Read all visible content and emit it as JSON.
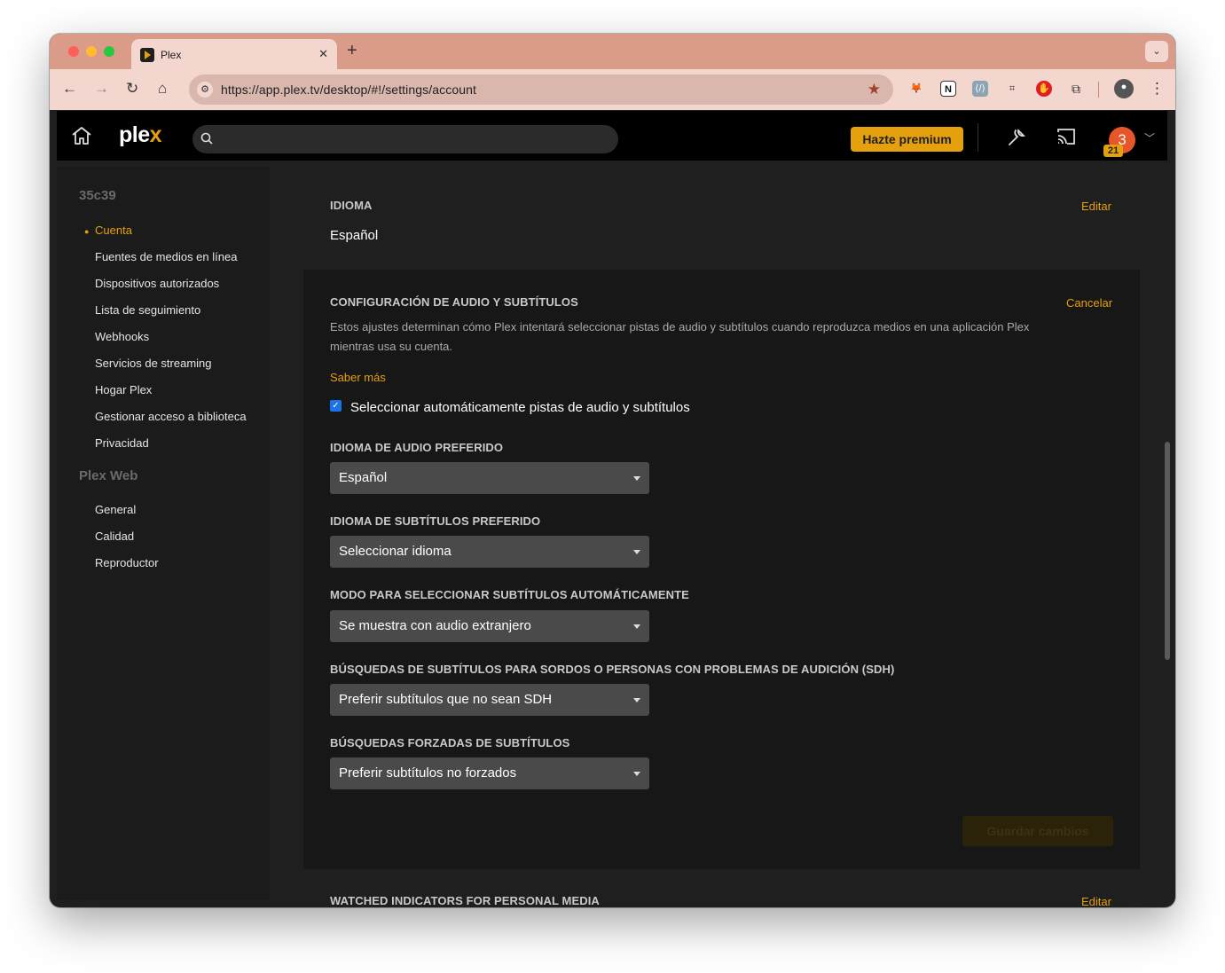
{
  "browser": {
    "tab_title": "Plex",
    "url": "https://app.plex.tv/desktop/#!/settings/account"
  },
  "header": {
    "logo_text": "ple",
    "logo_accent": "x",
    "premium_label": "Hazte premium",
    "avatar_initial": "3",
    "avatar_badge": "21"
  },
  "sidebar": {
    "account_title": "35c39",
    "account_items": [
      {
        "label": "Cuenta",
        "active": true
      },
      {
        "label": "Fuentes de medios en línea"
      },
      {
        "label": "Dispositivos autorizados"
      },
      {
        "label": "Lista de seguimiento"
      },
      {
        "label": "Webhooks"
      },
      {
        "label": "Servicios de streaming"
      },
      {
        "label": "Hogar Plex"
      },
      {
        "label": "Gestionar acceso a biblioteca"
      },
      {
        "label": "Privacidad"
      }
    ],
    "web_title": "Plex Web",
    "web_items": [
      {
        "label": "General"
      },
      {
        "label": "Calidad"
      },
      {
        "label": "Reproductor"
      }
    ]
  },
  "main": {
    "language": {
      "label": "IDIOMA",
      "edit": "Editar",
      "value": "Español"
    },
    "audio_subs": {
      "label": "CONFIGURACIÓN DE AUDIO Y SUBTÍTULOS",
      "cancel": "Cancelar",
      "description": "Estos ajustes determinan cómo Plex intentará seleccionar pistas de audio y subtítulos cuando reproduzca medios en una aplicación Plex mientras usa su cuenta.",
      "learn_more": "Saber más",
      "auto_select_label": "Seleccionar automáticamente pistas de audio y subtítulos",
      "auto_select_checked": true,
      "fields": [
        {
          "label": "IDIOMA DE AUDIO PREFERIDO",
          "value": "Español"
        },
        {
          "label": "IDIOMA DE SUBTÍTULOS PREFERIDO",
          "value": "Seleccionar idioma"
        },
        {
          "label": "MODO PARA SELECCIONAR SUBTÍTULOS AUTOMÁTICAMENTE",
          "value": "Se muestra con audio extranjero"
        },
        {
          "label": "BÚSQUEDAS DE SUBTÍTULOS PARA SORDOS O PERSONAS CON PROBLEMAS DE AUDICIÓN (SDH)",
          "value": "Preferir subtítulos que no sean SDH"
        },
        {
          "label": "BÚSQUEDAS FORZADAS DE SUBTÍTULOS",
          "value": "Preferir subtítulos no forzados"
        }
      ],
      "save_label": "Guardar cambios"
    },
    "watched": {
      "label": "WATCHED INDICATORS FOR PERSONAL MEDIA",
      "edit": "Editar"
    }
  },
  "colors": {
    "accent": "#e5a00d",
    "background": "#1f1f1f",
    "header": "#000000",
    "tab_strip": "#db9b89"
  },
  "icons": [
    "home-icon",
    "search-icon",
    "wrench-icon",
    "cast-icon",
    "chevron-down-icon",
    "star-icon",
    "checkbox-icon"
  ]
}
